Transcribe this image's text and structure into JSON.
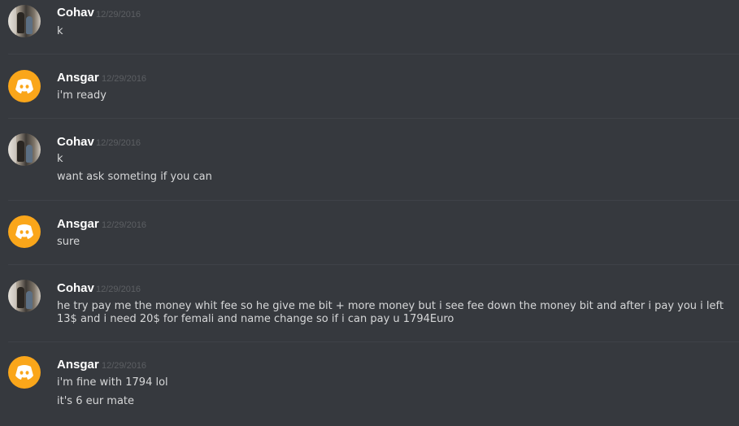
{
  "messages": [
    {
      "author": "Cohav",
      "timestamp": "12/29/2016",
      "avatar": "user-photo",
      "lines": [
        "k"
      ]
    },
    {
      "author": "Ansgar",
      "timestamp": "12/29/2016",
      "avatar": "discord-default",
      "lines": [
        "i'm ready"
      ]
    },
    {
      "author": "Cohav",
      "timestamp": "12/29/2016",
      "avatar": "user-photo",
      "lines": [
        "k",
        "want ask someting if you can"
      ]
    },
    {
      "author": "Ansgar",
      "timestamp": "12/29/2016",
      "avatar": "discord-default",
      "lines": [
        "sure"
      ]
    },
    {
      "author": "Cohav",
      "timestamp": "12/29/2016",
      "avatar": "user-photo",
      "lines": [
        "he try pay me the money whit fee so he give me bit + more money but i see fee down the money bit and after i pay you i left 13$ and i need 20$ for femali and name change so if i can pay u 1794Euro"
      ]
    },
    {
      "author": "Ansgar",
      "timestamp": "12/29/2016",
      "avatar": "discord-default",
      "lines": [
        "i'm fine with 1794 lol",
        "it's 6 eur mate"
      ]
    }
  ],
  "colors": {
    "background": "#36393e",
    "username": "#ffffff",
    "timestamp": "#5c5f63",
    "message_text": "#d6d7d8",
    "discord_avatar": "#faa61a",
    "divider": "#3f4248"
  },
  "icons": {
    "photo_avatar": "user-photo-avatar",
    "default_avatar": "discord-logo-icon"
  }
}
